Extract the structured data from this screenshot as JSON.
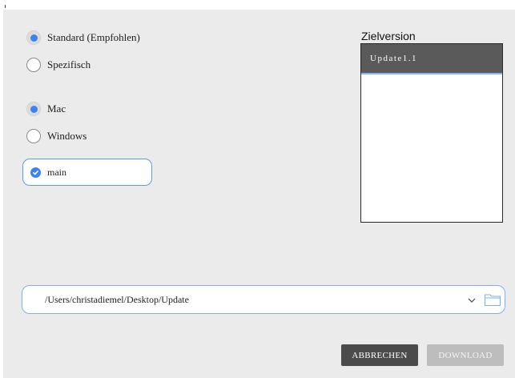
{
  "options": {
    "update_mode": [
      {
        "label": "Standard (Empfohlen)",
        "selected": true
      },
      {
        "label": "Spezifisch",
        "selected": false
      }
    ],
    "platform": [
      {
        "label": "Mac",
        "selected": true
      },
      {
        "label": "Windows",
        "selected": false
      }
    ]
  },
  "branch": {
    "label": "main",
    "checked": true,
    "icon": "check-icon"
  },
  "target_version": {
    "title": "Zielversion",
    "items": [
      "Update1.1"
    ],
    "selected": "Update1.1"
  },
  "path": {
    "value": "/Users/christadiemel/Desktop/Update",
    "dropdown_icon": "chevron-down-icon",
    "folder_icon": "folder-icon"
  },
  "buttons": {
    "cancel": "ABBRECHEN",
    "download": "DOWNLOAD",
    "download_disabled": true
  },
  "colors": {
    "accent": "#3b82f6",
    "panel_bg": "#ebebeb",
    "cancel_bg": "#4b4b4b",
    "download_disabled_bg": "#bdbdbd",
    "selected_list_item_bg": "#5a5a5a"
  }
}
